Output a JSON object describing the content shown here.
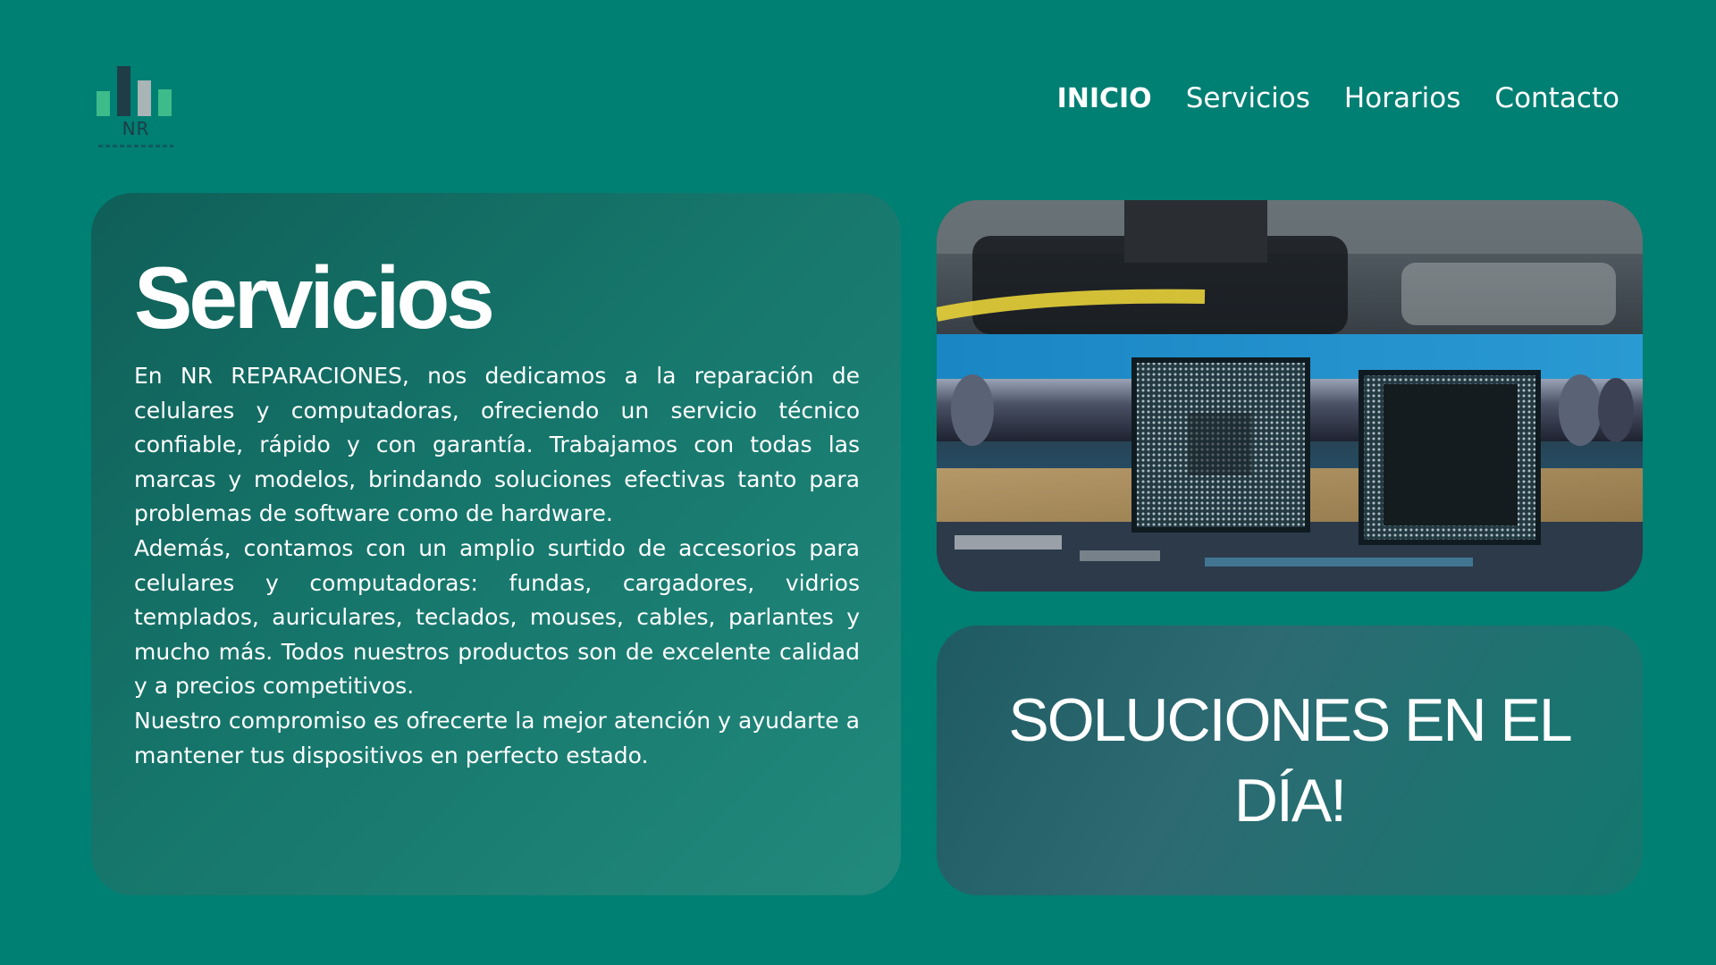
{
  "logo": {
    "text": "NR",
    "bar_colors": [
      "#3dbb8a",
      "#1e3d47",
      "#a9b4b6",
      "#3dbb8a"
    ]
  },
  "nav": {
    "items": [
      {
        "label": "INICIO",
        "active": true
      },
      {
        "label": "Servicios",
        "active": false
      },
      {
        "label": "Horarios",
        "active": false
      },
      {
        "label": "Contacto",
        "active": false
      }
    ]
  },
  "services": {
    "title": "Servicios",
    "paragraphs": [
      "En NR REPARACIONES, nos dedicamos a la reparación de celulares y computadoras, ofreciendo un servicio técnico confiable, rápido y con garantía. Trabajamos con todas las marcas y modelos, brindando soluciones efectivas tanto para problemas de software como de hardware.",
      "Además, contamos con un amplio surtido de accesorios para celulares y computadoras: fundas, cargadores, vidrios templados, auriculares, teclados, mouses, cables, parlantes y mucho más. Todos nuestros productos son de excelente calidad y a precios competitivos.",
      "Nuestro compromiso es ofrecerte la mejor atención y ayudarte a mantener tus dispositivos en perfecto estado."
    ]
  },
  "photo": {
    "icon": "chips-photo"
  },
  "banner": {
    "text": "SOLUCIONES EN EL DÍA!"
  },
  "colors": {
    "background": "#007f73",
    "accent": "#3dbb8a",
    "text": "#ffffff"
  }
}
